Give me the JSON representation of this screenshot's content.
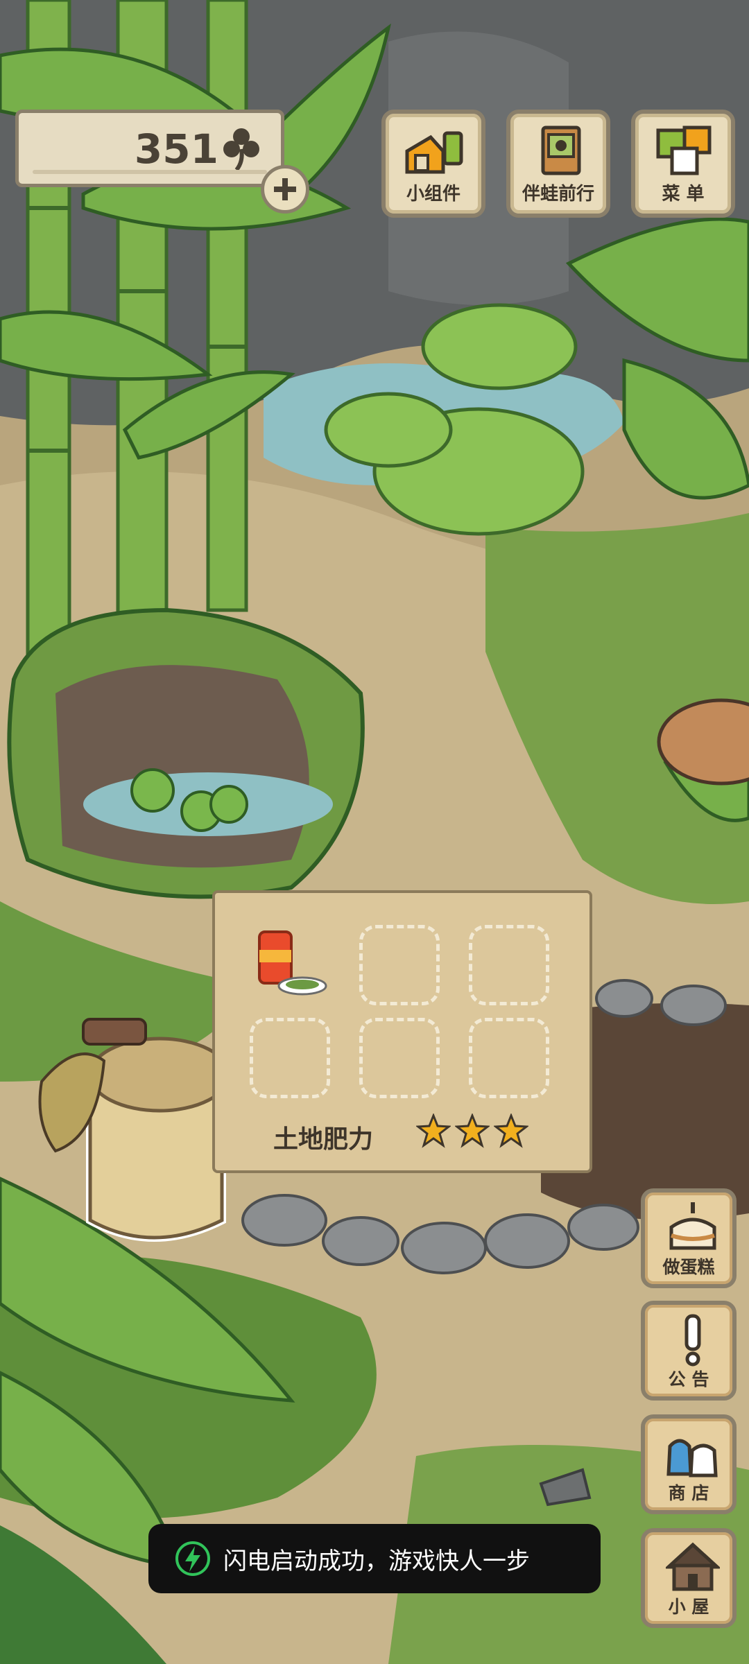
{
  "counter": {
    "value": "351",
    "icon": "clover-icon"
  },
  "top_buttons": [
    {
      "label": "小组件",
      "icon": "widget-icon"
    },
    {
      "label": "伴蛙前行",
      "icon": "journey-icon"
    },
    {
      "label": "菜 单",
      "icon": "menu-icon"
    }
  ],
  "planter": {
    "fertility_label": "土地肥力",
    "fertility_stars": 3,
    "slots_total": 6,
    "filled_slots": 1
  },
  "side_buttons": [
    {
      "label": "做蛋糕",
      "icon": "cake-icon"
    },
    {
      "label": "公 告",
      "icon": "exclamation-icon"
    },
    {
      "label": "商 店",
      "icon": "shop-bags-icon"
    },
    {
      "label": "小 屋",
      "icon": "house-icon"
    }
  ],
  "toast": {
    "text": "闪电启动成功，游戏快人一步",
    "icon": "lightning-icon"
  },
  "colors": {
    "accent_green": "#31c35a",
    "star_yellow": "#f2b01e",
    "panel": "#e9dcbc"
  }
}
